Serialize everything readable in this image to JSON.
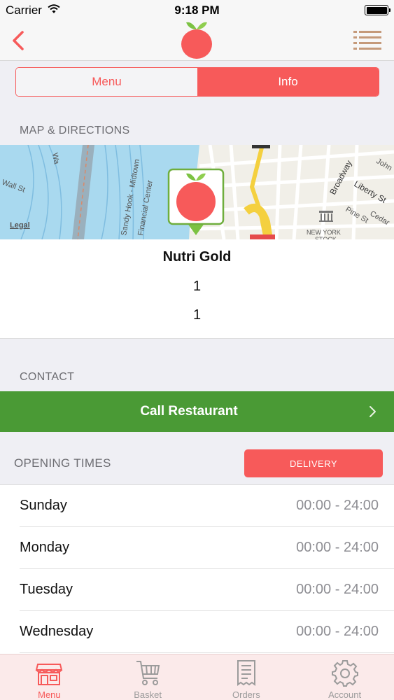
{
  "status_bar": {
    "carrier": "Carrier",
    "time": "9:18 PM"
  },
  "segments": {
    "menu": "Menu",
    "info": "Info",
    "selected": "Info"
  },
  "map_section": {
    "header": "MAP & DIRECTIONS",
    "legal": "Legal",
    "street_labels": [
      "Wall St",
      "Sandy Hook - Midtown",
      "Financial Center",
      "Broadway",
      "Liberty St",
      "Pine St",
      "Cedar",
      "NEW YORK STOCK",
      "John"
    ]
  },
  "restaurant": {
    "name": "Nutri Gold",
    "address_line1": "1",
    "address_line2": "1"
  },
  "contact": {
    "header": "CONTACT",
    "call_label": "Call Restaurant"
  },
  "opening_times": {
    "header": "OPENING TIMES",
    "mode_button": "DELIVERY",
    "days": [
      {
        "day": "Sunday",
        "hours": "00:00 - 24:00"
      },
      {
        "day": "Monday",
        "hours": "00:00 - 24:00"
      },
      {
        "day": "Tuesday",
        "hours": "00:00 - 24:00"
      },
      {
        "day": "Wednesday",
        "hours": "00:00 - 24:00"
      }
    ]
  },
  "tabs": [
    {
      "label": "Menu",
      "icon": "store-icon",
      "active": true
    },
    {
      "label": "Basket",
      "icon": "cart-icon",
      "active": false
    },
    {
      "label": "Orders",
      "icon": "receipt-icon",
      "active": false
    },
    {
      "label": "Account",
      "icon": "gear-icon",
      "active": false
    }
  ],
  "colors": {
    "accent": "#f75a5a",
    "call_green": "#4a9a35",
    "logo_leaf": "#7cc243"
  }
}
